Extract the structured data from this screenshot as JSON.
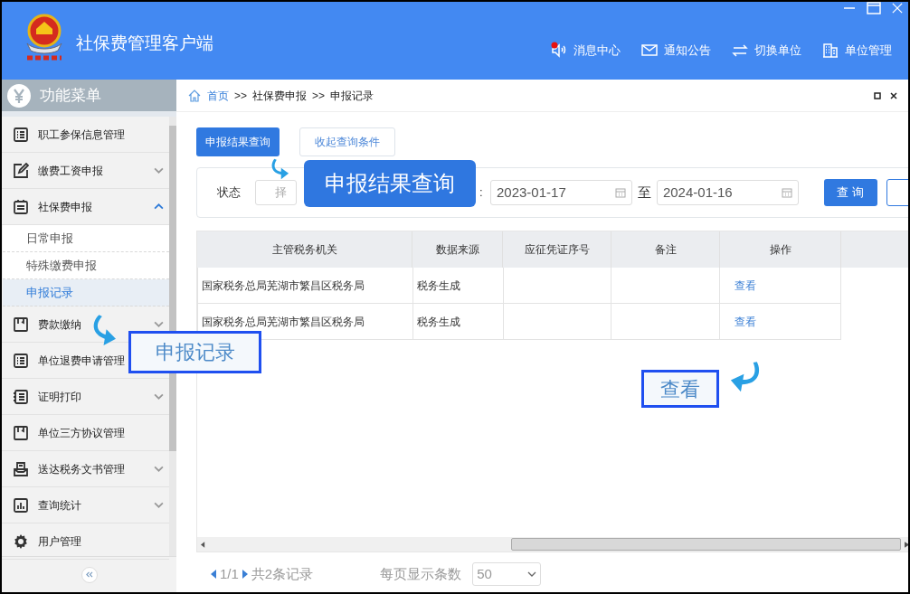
{
  "window": {
    "title": "社保费管理客户端"
  },
  "header_links": [
    {
      "label": "消息中心",
      "kind": "message",
      "unread": true
    },
    {
      "label": "通知公告",
      "kind": "notice",
      "unread": false
    },
    {
      "label": "切换单位",
      "kind": "switch",
      "unread": false
    },
    {
      "label": "单位管理",
      "kind": "unit",
      "unread": false
    }
  ],
  "sidebar": {
    "title": "功能菜单",
    "items": [
      {
        "label": "职工参保信息管理",
        "kind": "link"
      },
      {
        "label": "缴费工资申报",
        "kind": "group",
        "expanded": false
      },
      {
        "label": "社保费申报",
        "kind": "group",
        "expanded": true,
        "children": [
          {
            "label": "日常申报",
            "selected": false
          },
          {
            "label": "特殊缴费申报",
            "selected": false
          },
          {
            "label": "申报记录",
            "selected": true
          }
        ]
      },
      {
        "label": "费款缴纳",
        "kind": "group",
        "expanded": false
      },
      {
        "label": "单位退费申请管理",
        "kind": "link"
      },
      {
        "label": "证明打印",
        "kind": "group",
        "expanded": false
      },
      {
        "label": "单位三方协议管理",
        "kind": "link"
      },
      {
        "label": "送达税务文书管理",
        "kind": "group",
        "expanded": false
      },
      {
        "label": "查询统计",
        "kind": "group",
        "expanded": false
      },
      {
        "label": "用户管理",
        "kind": "link"
      }
    ]
  },
  "breadcrumb": [
    {
      "label": "首页",
      "kind": "link"
    },
    {
      "label": ">>",
      "kind": "sep"
    },
    {
      "label": "社保费申报",
      "kind": "text"
    },
    {
      "label": ">>",
      "kind": "sep"
    },
    {
      "label": "申报记录",
      "kind": "text"
    }
  ],
  "tabs": [
    {
      "label": "申报结果查询",
      "selected": true
    },
    {
      "label": "收起查询条件",
      "selected": false
    }
  ],
  "filter": {
    "status_label": "状态",
    "status_placeholder": "择",
    "date_label": ":",
    "date_from": "2023-01-17",
    "to_label": "至",
    "date_to": "2024-01-16",
    "search_button": "查 询"
  },
  "table": {
    "columns": [
      "主管税务机关",
      "数据来源",
      "应征凭证序号",
      "备注",
      "操作"
    ],
    "rows": [
      [
        "国家税务总局芜湖市繁昌区税务局",
        "税务生成",
        "",
        "",
        "查看"
      ],
      [
        "国家税务总局芜湖市繁昌区税务局",
        "税务生成",
        "",
        "",
        "查看"
      ]
    ]
  },
  "pagination": {
    "page": "1/1",
    "total": "共2条记录",
    "page_size_label": "每页显示条数",
    "page_size": "50"
  },
  "callouts": [
    {
      "text": "申报结果查询",
      "kind": "solid"
    },
    {
      "text": "申报记录",
      "kind": "outline"
    },
    {
      "text": "查看",
      "kind": "outline"
    }
  ]
}
